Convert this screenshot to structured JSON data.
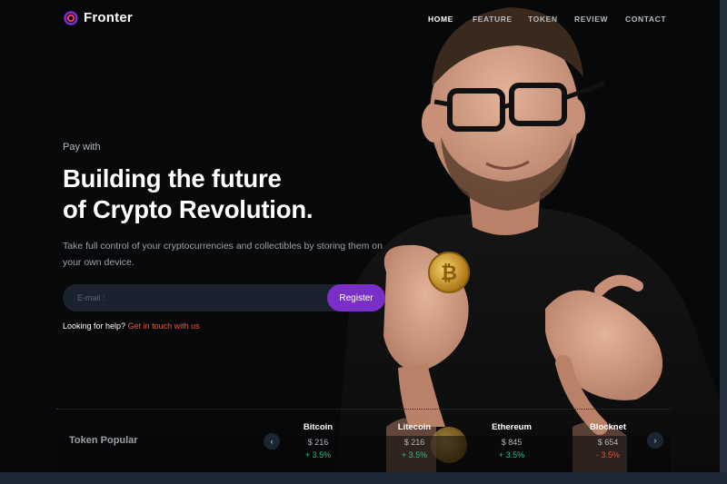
{
  "brand": {
    "name": "Fronter",
    "accent": "#7b2fc9",
    "link_color": "#ee5a3b"
  },
  "nav": {
    "items": [
      {
        "label": "HOME",
        "active": true
      },
      {
        "label": "FEATURE",
        "active": false
      },
      {
        "label": "TOKEN",
        "active": false
      },
      {
        "label": "REVIEW",
        "active": false
      },
      {
        "label": "CONTACT",
        "active": false
      }
    ]
  },
  "hero": {
    "eyebrow": "Pay with",
    "headline_line1": "Building the future",
    "headline_line2": "of Crypto Revolution.",
    "lead": "Take full control of your cryptocurrencies and collectibles by storing them on your own device."
  },
  "subscribe": {
    "placeholder": "E-mail :",
    "button_label": "Register"
  },
  "help": {
    "text": "Looking for help?",
    "link": "Get in touch with us"
  },
  "tokens": {
    "title": "Token Popular",
    "prev_icon": "chevron-left-icon",
    "next_icon": "chevron-right-icon",
    "items": [
      {
        "name": "Bitcoin",
        "price": "$ 216",
        "change": "+ 3.5%",
        "trend": "up"
      },
      {
        "name": "Litecoin",
        "price": "$ 216",
        "change": "+ 3.5%",
        "trend": "up"
      },
      {
        "name": "Ethereum",
        "price": "$ 845",
        "change": "+ 3.5%",
        "trend": "up"
      },
      {
        "name": "Blocknet",
        "price": "$ 654",
        "change": "- 3.5%",
        "trend": "down"
      }
    ]
  }
}
